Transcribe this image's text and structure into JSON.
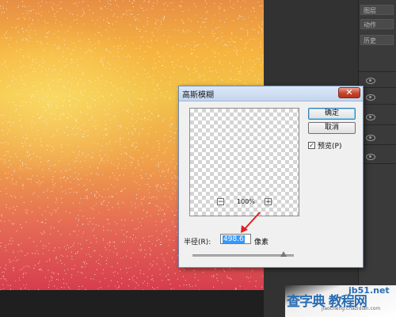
{
  "dialog": {
    "title": "高斯模糊",
    "close_symbol": "✕",
    "ok_label": "确定",
    "cancel_label": "取消",
    "preview_checked": true,
    "preview_label": "预览(P)",
    "zoom_minus": "−",
    "zoom_plus": "+",
    "zoom_level": "100%",
    "radius_label": "半径(R):",
    "radius_value": "498.6",
    "unit_label": "像素",
    "radius_slider_fraction": 0.9
  },
  "panel": {
    "tabs": [
      "图层",
      "动作",
      "历史"
    ]
  },
  "watermark": {
    "site_main": "查字典 教程网",
    "site_short": "jb51.net",
    "site_url": "jiaocheng.chazidian.com"
  },
  "colors": {
    "accent_arrow": "#e02020",
    "selection": "#3399ff"
  }
}
